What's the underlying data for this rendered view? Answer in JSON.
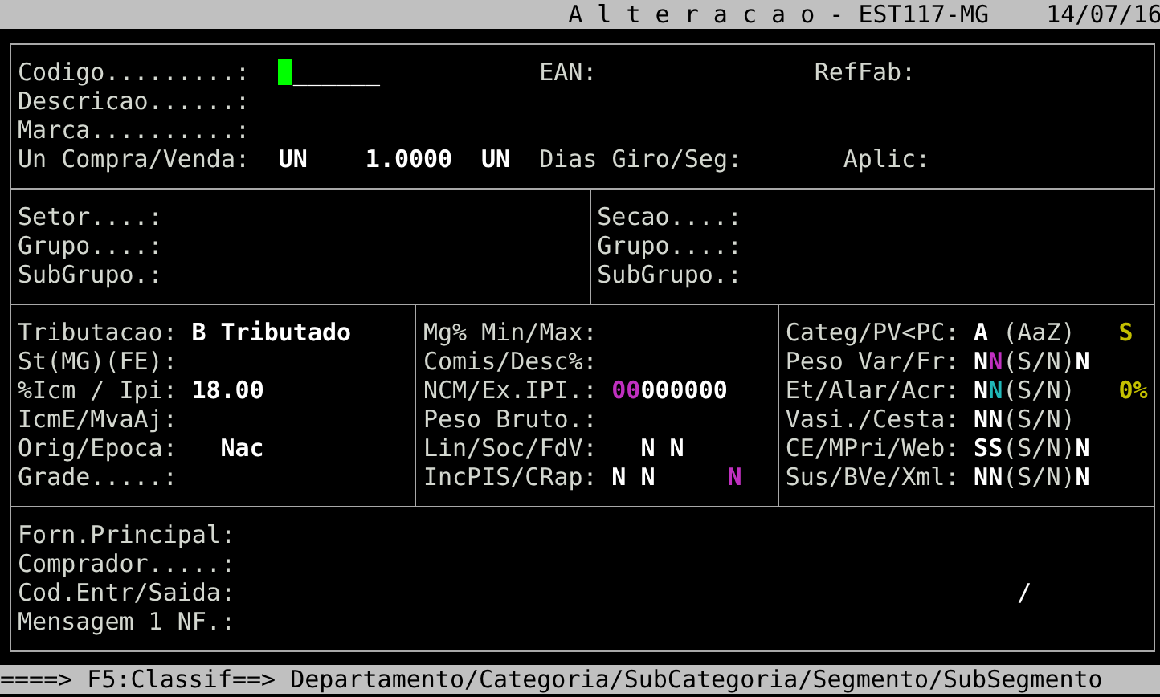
{
  "title_bar": {
    "title": "A l t e r a c a o - EST117-MG",
    "date": "14/07/16"
  },
  "sections": [
    {
      "rows": [
        {
          "items": [
            {
              "kind": "label",
              "text": "Codigo.........:"
            },
            {
              "kind": "input",
              "value": "______",
              "focused": true
            },
            {
              "kind": "label",
              "text": "EAN:"
            },
            {
              "kind": "label",
              "text": "RefFab:"
            }
          ]
        },
        {
          "items": [
            {
              "kind": "label",
              "text": "Descricao......:"
            }
          ]
        },
        {
          "items": [
            {
              "kind": "label",
              "text": "Marca..........:"
            }
          ]
        },
        {
          "items": [
            {
              "kind": "label",
              "text": "Un Compra/Venda:"
            },
            {
              "kind": "value",
              "parts": [
                {
                  "text": "UN",
                  "color": "#ffffff",
                  "bold": true
                }
              ]
            },
            {
              "kind": "value",
              "parts": [
                {
                  "text": "1.0000",
                  "color": "#ffffff",
                  "bold": true
                }
              ]
            },
            {
              "kind": "value",
              "parts": [
                {
                  "text": "UN",
                  "color": "#ffffff",
                  "bold": true
                }
              ]
            },
            {
              "kind": "label",
              "text": "Dias Giro/Seg:"
            },
            {
              "kind": "label",
              "text": "Aplic:"
            }
          ]
        }
      ]
    },
    {
      "rows": [
        {
          "items": [
            {
              "kind": "label",
              "text": "Setor....:"
            },
            {
              "kind": "label",
              "text": "Secao....:"
            }
          ]
        },
        {
          "items": [
            {
              "kind": "label",
              "text": "Grupo....:"
            },
            {
              "kind": "label",
              "text": "Grupo....:"
            }
          ]
        },
        {
          "items": [
            {
              "kind": "label",
              "text": "SubGrupo.:"
            },
            {
              "kind": "label",
              "text": "SubGrupo.:"
            }
          ]
        }
      ]
    },
    {
      "rows": [
        {
          "items": [
            {
              "kind": "label",
              "text": "Tributacao:"
            },
            {
              "kind": "value",
              "parts": [
                {
                  "text": "B Tributado",
                  "color": "#ffffff",
                  "bold": true
                }
              ]
            },
            {
              "kind": "label",
              "text": "Mg% Min/Max:"
            },
            {
              "kind": "label",
              "text": "Categ/PV<PC:"
            },
            {
              "kind": "value",
              "parts": [
                {
                  "text": "A",
                  "color": "#ffffff",
                  "bold": true
                },
                {
                  "text": " (AaZ)",
                  "color": "#d3d7cf",
                  "bold": false
                }
              ]
            },
            {
              "kind": "value",
              "parts": [
                {
                  "text": "S",
                  "color": "#c4c000",
                  "bold": true
                }
              ]
            }
          ]
        },
        {
          "items": [
            {
              "kind": "label",
              "text": "St(MG)(FE):"
            },
            {
              "kind": "label",
              "text": "Comis/Desc%:"
            },
            {
              "kind": "label",
              "text": "Peso Var/Fr:"
            },
            {
              "kind": "value",
              "parts": [
                {
                  "text": "N",
                  "color": "#ffffff",
                  "bold": true
                },
                {
                  "text": "N",
                  "color": "#c030c0",
                  "bold": true
                },
                {
                  "text": "(S/N)",
                  "color": "#d3d7cf",
                  "bold": false
                },
                {
                  "text": "N",
                  "color": "#ffffff",
                  "bold": true
                }
              ]
            }
          ]
        },
        {
          "items": [
            {
              "kind": "label",
              "text": "%Icm / Ipi:"
            },
            {
              "kind": "value",
              "parts": [
                {
                  "text": "18.00",
                  "color": "#ffffff",
                  "bold": true
                }
              ]
            },
            {
              "kind": "label",
              "text": "NCM/Ex.IPI.:"
            },
            {
              "kind": "value",
              "parts": [
                {
                  "text": "00",
                  "color": "#c030c0",
                  "bold": true
                },
                {
                  "text": "000000",
                  "color": "#ffffff",
                  "bold": true
                }
              ]
            },
            {
              "kind": "label",
              "text": "Et/Alar/Acr:"
            },
            {
              "kind": "value",
              "parts": [
                {
                  "text": "N",
                  "color": "#ffffff",
                  "bold": true
                },
                {
                  "text": "N",
                  "color": "#20b8b8",
                  "bold": true
                },
                {
                  "text": "(S/N)",
                  "color": "#d3d7cf",
                  "bold": false
                }
              ]
            },
            {
              "kind": "value",
              "parts": [
                {
                  "text": "0%",
                  "color": "#c4c000",
                  "bold": true
                }
              ]
            }
          ]
        },
        {
          "items": [
            {
              "kind": "label",
              "text": "IcmE/MvaAj:"
            },
            {
              "kind": "label",
              "text": "Peso Bruto.:"
            },
            {
              "kind": "label",
              "text": "Vasi./Cesta:"
            },
            {
              "kind": "value",
              "parts": [
                {
                  "text": "NN",
                  "color": "#ffffff",
                  "bold": true
                },
                {
                  "text": "(S/N)",
                  "color": "#d3d7cf",
                  "bold": false
                }
              ]
            }
          ]
        },
        {
          "items": [
            {
              "kind": "label",
              "text": "Orig/Epoca:"
            },
            {
              "kind": "value",
              "parts": [
                {
                  "text": "Nac",
                  "color": "#ffffff",
                  "bold": true
                }
              ]
            },
            {
              "kind": "label",
              "text": "Lin/Soc/FdV:"
            },
            {
              "kind": "value",
              "parts": [
                {
                  "text": "N N",
                  "color": "#ffffff",
                  "bold": true
                }
              ]
            },
            {
              "kind": "label",
              "text": "CE/MPri/Web:"
            },
            {
              "kind": "value",
              "parts": [
                {
                  "text": "SS",
                  "color": "#ffffff",
                  "bold": true
                },
                {
                  "text": "(S/N)",
                  "color": "#d3d7cf",
                  "bold": false
                },
                {
                  "text": "N",
                  "color": "#ffffff",
                  "bold": true
                }
              ]
            }
          ]
        },
        {
          "items": [
            {
              "kind": "label",
              "text": "Grade.....:"
            },
            {
              "kind": "label",
              "text": "IncPIS/CRap:"
            },
            {
              "kind": "value",
              "parts": [
                {
                  "text": "N N",
                  "color": "#ffffff",
                  "bold": true
                }
              ]
            },
            {
              "kind": "value",
              "parts": [
                {
                  "text": "N",
                  "color": "#c030c0",
                  "bold": true
                }
              ]
            },
            {
              "kind": "label",
              "text": "Sus/BVe/Xml:"
            },
            {
              "kind": "value",
              "parts": [
                {
                  "text": "NN",
                  "color": "#ffffff",
                  "bold": true
                },
                {
                  "text": "(S/N)",
                  "color": "#d3d7cf",
                  "bold": false
                },
                {
                  "text": "N",
                  "color": "#ffffff",
                  "bold": true
                }
              ]
            }
          ]
        }
      ]
    },
    {
      "rows": [
        {
          "items": [
            {
              "kind": "label",
              "text": "Forn.Principal:"
            }
          ]
        },
        {
          "items": [
            {
              "kind": "label",
              "text": "Comprador.....:"
            }
          ]
        },
        {
          "items": [
            {
              "kind": "label",
              "text": "Cod.Entr/Saida:"
            },
            {
              "kind": "value",
              "parts": [
                {
                  "text": "/",
                  "color": "#ffffff",
                  "bold": false
                }
              ]
            }
          ]
        },
        {
          "items": [
            {
              "kind": "label",
              "text": "Mensagem 1 NF.:"
            }
          ]
        }
      ]
    }
  ],
  "status_bar": {
    "text": "====> F5:Classif==> Departamento/Categoria/SubCategoria/Segmento/SubSegmento"
  }
}
